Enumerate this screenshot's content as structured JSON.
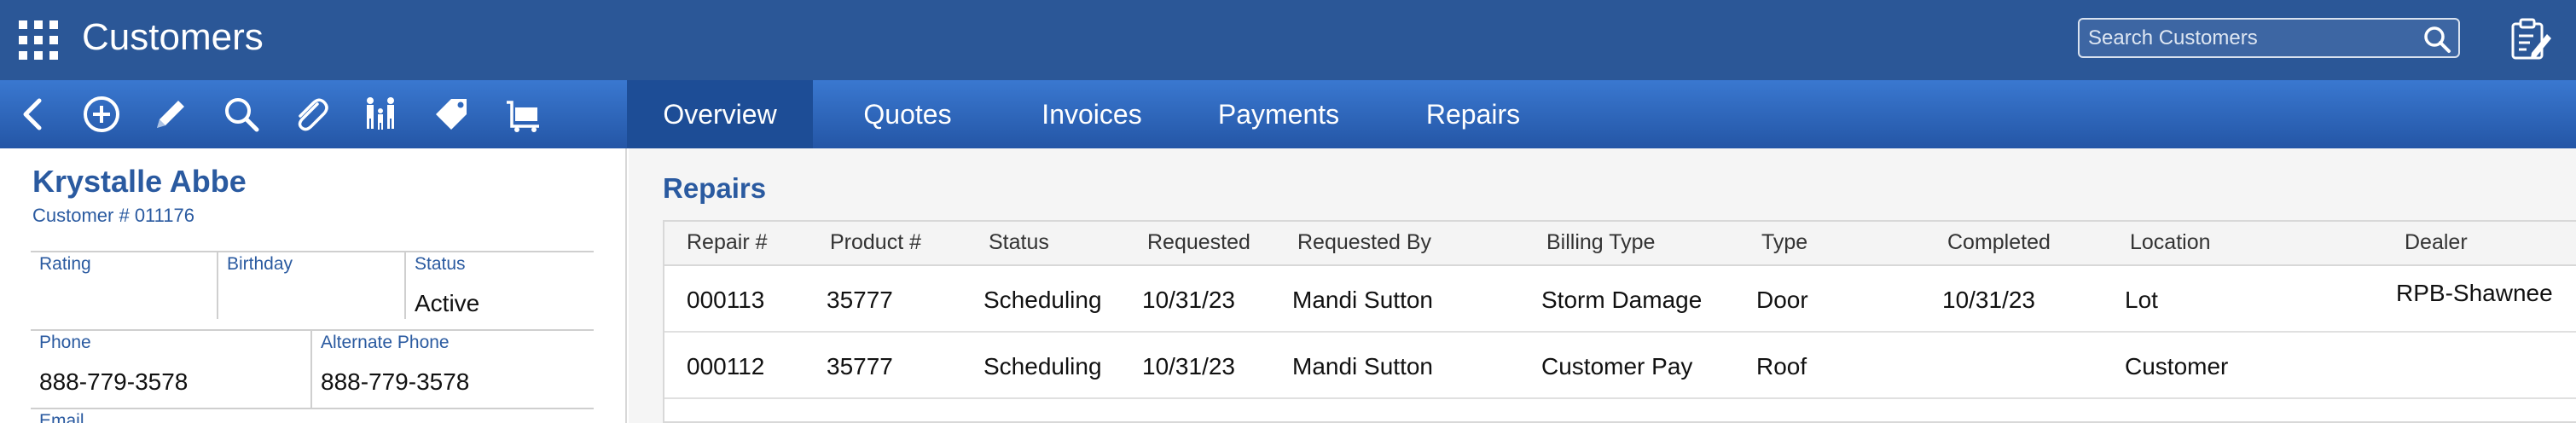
{
  "header": {
    "apps_icon": "grid-icon",
    "title": "Customers",
    "search": {
      "placeholder": "Search Customers",
      "value": "",
      "icon": "magnifier-icon"
    },
    "clipboard_icon": "clipboard-edit-icon"
  },
  "toolbar": {
    "icons": [
      "back-arrow-icon",
      "add-circle-icon",
      "pencil-icon",
      "search-icon",
      "paperclip-icon",
      "family-icon",
      "tag-icon",
      "cart-icon"
    ]
  },
  "tabs": [
    {
      "label": "Overview",
      "active": true
    },
    {
      "label": "Quotes",
      "active": false
    },
    {
      "label": "Invoices",
      "active": false
    },
    {
      "label": "Payments",
      "active": false
    },
    {
      "label": "Repairs",
      "active": false
    }
  ],
  "customer": {
    "name": "Krystalle Abbe",
    "number_label": "Customer # 011176",
    "fields": {
      "rating_label": "Rating",
      "rating_value": "",
      "birthday_label": "Birthday",
      "birthday_value": "",
      "status_label": "Status",
      "status_value": "Active",
      "phone_label": "Phone",
      "phone_value": "888-779-3578",
      "alt_phone_label": "Alternate Phone",
      "alt_phone_value": "888-779-3578",
      "email_label": "Email"
    }
  },
  "repairs": {
    "title": "Repairs",
    "columns": [
      "Repair #",
      "Product #",
      "Status",
      "Requested",
      "Requested By",
      "Billing Type",
      "Type",
      "Completed",
      "Location",
      "Dealer"
    ],
    "rows": [
      [
        "000113",
        "35777",
        "Scheduling",
        "10/31/23",
        "Mandi Sutton",
        "Storm Damage",
        "Door",
        "10/31/23",
        "Lot",
        "RPB-Shawnee"
      ],
      [
        "000112",
        "35777",
        "Scheduling",
        "10/31/23",
        "Mandi Sutton",
        "Customer Pay",
        "Roof",
        "",
        "Customer",
        ""
      ]
    ]
  },
  "colors": {
    "header_bg": "#2b5797",
    "toolbar_bg": "#2f68bd",
    "active_tab": "#1d4d96",
    "accent_text": "#2a5aa0"
  }
}
